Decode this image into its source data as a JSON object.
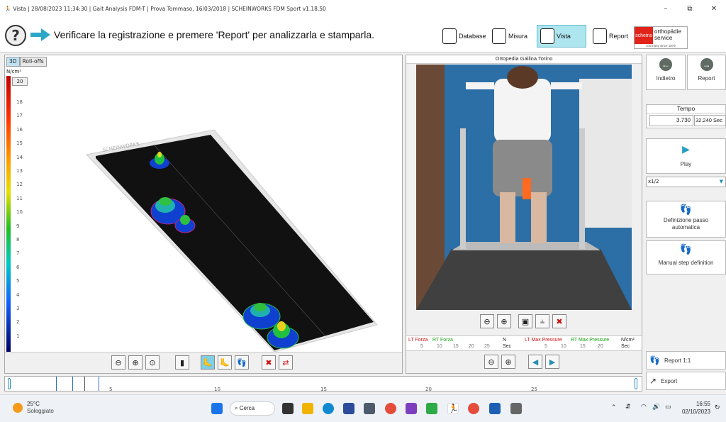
{
  "window": {
    "title": "Vista | 28/08/2023 11:34:30 | Gait Analysis FDM-T | Prova Tommaso, 16/03/2018 | SCHEINWORKS FDM Sport v1.18.50",
    "minimize": "–",
    "maximize": "⧉",
    "close": "✕"
  },
  "toolbar": {
    "instruction": "Verificare la registrazione e premere 'Report' per analizzarla e stamparla.",
    "help_glyph": "?",
    "nav": [
      {
        "label": "Database",
        "icon": "database-icon"
      },
      {
        "label": "Misura",
        "icon": "measure-icon"
      },
      {
        "label": "Vista",
        "icon": "view-icon"
      },
      {
        "label": "Report",
        "icon": "report-icon"
      }
    ],
    "active_nav": "Vista",
    "logo": {
      "brand": "scheins",
      "name_line1": "orthopädie",
      "name_line2": "service",
      "tagline": "Germany since 1879"
    }
  },
  "view3d": {
    "tabs": [
      "3D",
      "Roll-offs"
    ],
    "active_tab": "3D",
    "scale_unit": "N/cm²",
    "scale_max_input": "20",
    "scale_labels": [
      "18",
      "17",
      "16",
      "15",
      "14",
      "13",
      "12",
      "11",
      "10",
      "9",
      "8",
      "7",
      "6",
      "5",
      "4",
      "3",
      "2",
      "1"
    ],
    "watermark": "SCHEINWORKS"
  },
  "video": {
    "title": "Ortopedia Gallina Torino"
  },
  "pressure_chart": {
    "lt_force_label": "LT Forza",
    "rt_force_label": "RT Forza",
    "force_ticks": [
      "5",
      "10",
      "15",
      "20",
      "25"
    ],
    "force_unit_top": "N",
    "force_unit_bottom": "Sec",
    "lt_max_label": "LT Max Pressure",
    "rt_max_label": "RT Max Pressure",
    "max_ticks": [
      "5",
      "10",
      "15",
      "20"
    ],
    "max_unit_top": "N/cm²",
    "max_unit_bottom": "Sec"
  },
  "side": {
    "back_label": "Indietro",
    "report_label": "Report",
    "tempo_title": "Tempo",
    "tempo_current": "3.730",
    "tempo_total": "32.240 Sec",
    "play_label": "Play",
    "speed_value": "x1/2",
    "step_auto_label": "Definizione passo automatica",
    "step_manual_label": "Manual step definition",
    "report11_label": "Report 1:1",
    "export_label": "Export"
  },
  "timeline": {
    "ticks": [
      "5",
      "10",
      "15",
      "20",
      "25"
    ]
  },
  "taskbar": {
    "weather_temp": "25°C",
    "weather_desc": "Soleggiato",
    "search_label": "Cerca",
    "time": "16:55",
    "date": "02/10/2023"
  },
  "colors": {
    "accent": "#aee6ef",
    "lt_color": "#d01010",
    "rt_color": "#10a010"
  }
}
